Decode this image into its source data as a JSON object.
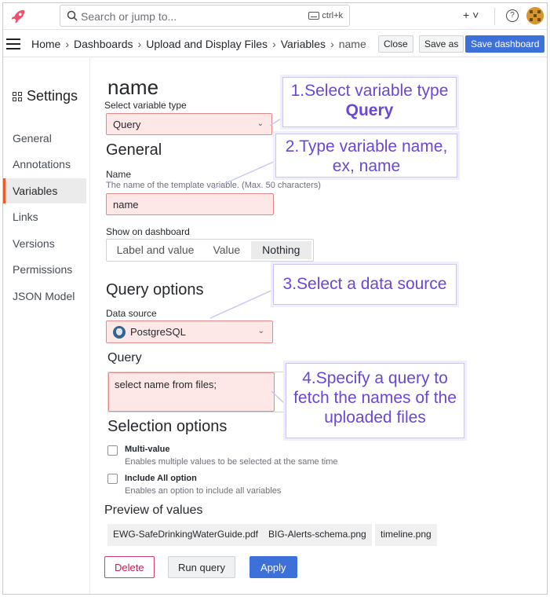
{
  "topbar": {
    "search_placeholder": "Search or jump to...",
    "shortcut": "ctrl+k",
    "new_menu": "+ ˅",
    "help_glyph": "?"
  },
  "breadcrumb": {
    "items": [
      "Home",
      "Dashboards",
      "Upload and Display Files",
      "Variables",
      "name"
    ],
    "separator": "›"
  },
  "toolbar": {
    "close_label": "Close",
    "save_as_label": "Save as",
    "save_dashboard_label": "Save dashboard"
  },
  "sidebar": {
    "title": "Settings",
    "items": [
      {
        "label": "General",
        "active": false
      },
      {
        "label": "Annotations",
        "active": false
      },
      {
        "label": "Variables",
        "active": true
      },
      {
        "label": "Links",
        "active": false
      },
      {
        "label": "Versions",
        "active": false
      },
      {
        "label": "Permissions",
        "active": false
      },
      {
        "label": "JSON Model",
        "active": false
      }
    ]
  },
  "main": {
    "variable_title": "name",
    "type_label": "Select variable type",
    "type_value": "Query",
    "general_heading": "General",
    "name_label": "Name",
    "name_description": "The name of the template variable. (Max. 50 characters)",
    "name_value": "name",
    "show_label": "Show on dashboard",
    "show_options": [
      "Label and value",
      "Value",
      "Nothing"
    ],
    "show_selected": "Nothing",
    "query_options_heading": "Query options",
    "data_source_label": "Data source",
    "data_source_value": "PostgreSQL",
    "query_label": "Query",
    "query_value": "select name from files;",
    "selection_heading": "Selection options",
    "multi_value_label": "Multi-value",
    "multi_value_desc": "Enables multiple values to be selected at the same time",
    "include_all_label": "Include All option",
    "include_all_desc": "Enables an option to include all variables",
    "preview_heading": "Preview of values",
    "preview_values": [
      "EWG-SafeDrinkingWaterGuide.pdf",
      "BIG-Alerts-schema.png",
      "timeline.png"
    ],
    "delete_label": "Delete",
    "run_query_label": "Run query",
    "apply_label": "Apply"
  },
  "callouts": {
    "c1_line1": "1.Select variable type",
    "c1_line2": "Query",
    "c2": "2.Type variable name, ex, name",
    "c3": "3.Select a data source",
    "c4": "4.Specify a query to fetch the names of the uploaded files"
  },
  "colors": {
    "accent_blue": "#3d71d9",
    "active_marker": "#f05a28",
    "highlight_fill": "#fde7e7",
    "callout_text": "#6b46d9"
  }
}
